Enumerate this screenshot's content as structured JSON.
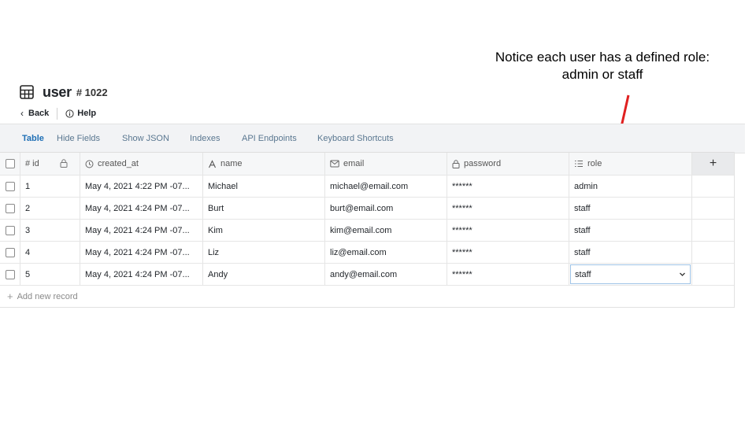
{
  "annotation": {
    "line1": "Notice each user has a defined role:",
    "line2": "admin or staff",
    "arrow_color": "#e02020"
  },
  "header": {
    "title": "user",
    "record_id": "# 1022",
    "back_label": "Back",
    "help_label": "Help"
  },
  "tabs": [
    {
      "label": "Table",
      "active": true
    },
    {
      "label": "Hide Fields"
    },
    {
      "label": "Show JSON"
    },
    {
      "label": "Indexes"
    },
    {
      "label": "API Endpoints"
    },
    {
      "label": "Keyboard Shortcuts"
    }
  ],
  "columns": {
    "id": "# id",
    "created_at": "created_at",
    "name": "name",
    "email": "email",
    "password": "password",
    "role": "role",
    "add": "+"
  },
  "rows": [
    {
      "id": "1",
      "created_at": "May 4, 2021 4:22 PM -07...",
      "name": "Michael",
      "email": "michael@email.com",
      "password": "******",
      "role": "admin"
    },
    {
      "id": "2",
      "created_at": "May 4, 2021 4:24 PM -07...",
      "name": "Burt",
      "email": "burt@email.com",
      "password": "******",
      "role": "staff"
    },
    {
      "id": "3",
      "created_at": "May 4, 2021 4:24 PM -07...",
      "name": "Kim",
      "email": "kim@email.com",
      "password": "******",
      "role": "staff"
    },
    {
      "id": "4",
      "created_at": "May 4, 2021 4:24 PM -07...",
      "name": "Liz",
      "email": "liz@email.com",
      "password": "******",
      "role": "staff"
    },
    {
      "id": "5",
      "created_at": "May 4, 2021 4:24 PM -07...",
      "name": "Andy",
      "email": "andy@email.com",
      "password": "******",
      "role": "staff",
      "editing": true
    }
  ],
  "add_record_label": "Add new record",
  "colors": {
    "active_tab": "#1f6fb5",
    "tab_text": "#5a7790",
    "toolbar_bg": "#f2f3f5",
    "select_border": "#9ec3e6"
  }
}
